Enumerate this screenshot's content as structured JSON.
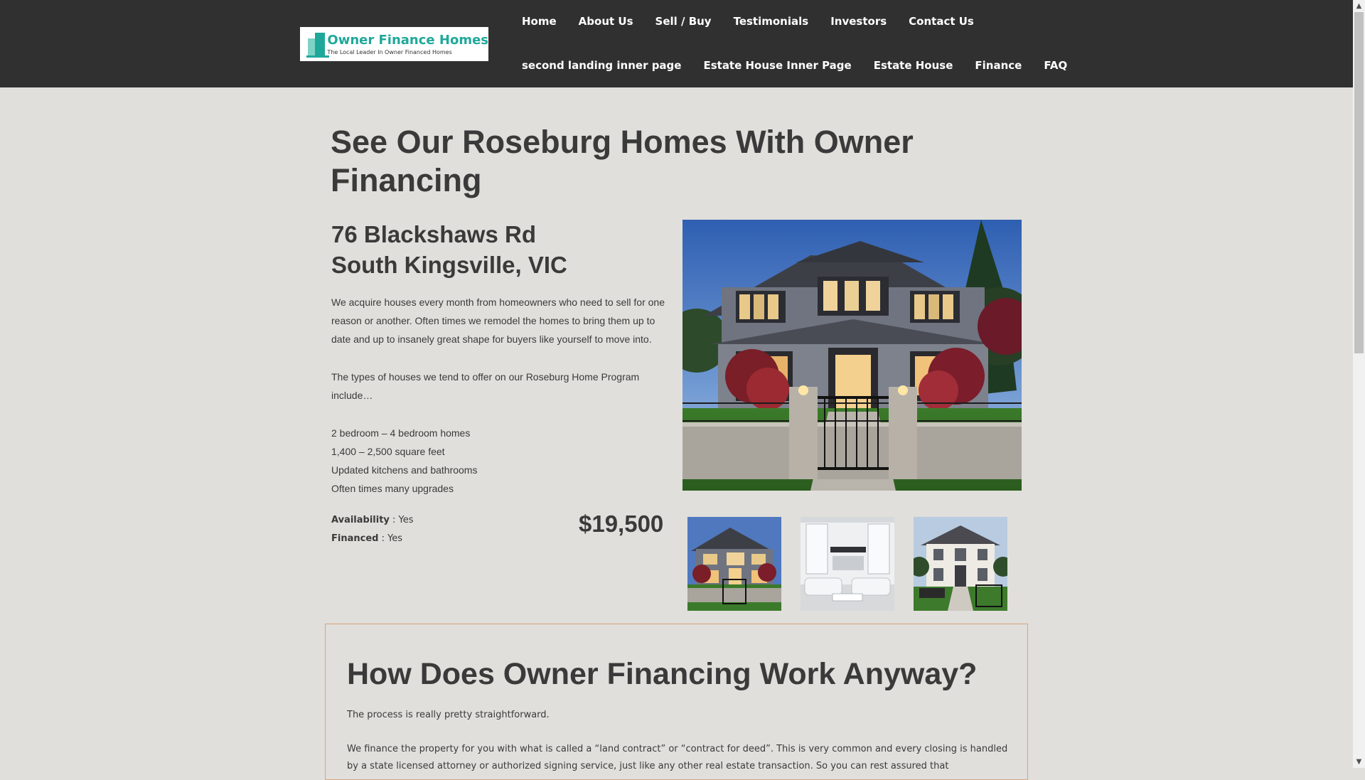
{
  "header": {
    "logo": {
      "title": "Owner Finance Homes",
      "tagline": "The Local Leader In Owner Financed Homes"
    },
    "nav_row1": [
      "Home",
      "About Us",
      "Sell / Buy",
      "Testimonials",
      "Investors",
      "Contact Us"
    ],
    "nav_row2": [
      "second landing inner page",
      "Estate House Inner Page",
      "Estate House",
      "Finance",
      "FAQ"
    ]
  },
  "main": {
    "title": "See Our Roseburg Homes With Owner Financing",
    "address_line1": "76 Blackshaws Rd",
    "address_line2": "South Kingsville, VIC",
    "intro": "We acquire houses every month from homeowners who need to sell for one reason or another. Often times we remodel the homes to bring them up to date and up to insanely great shape for buyers like yourself to move into.",
    "types_intro": "The types of houses we tend to offer on our Roseburg Home Program include…",
    "features": [
      "2 bedroom – 4 bedroom homes",
      "1,400 – 2,500 square feet",
      "Updated kitchens and bathrooms",
      "Often times many upgrades"
    ],
    "availability_label": "Availability",
    "availability_value": " : Yes",
    "financed_label": "Financed",
    "financed_value": " : Yes",
    "price": "$19,500"
  },
  "financing": {
    "title": "How Does Owner Financing Work Anyway?",
    "p1": "The process is really pretty straightforward.",
    "p2": "We finance the property for you with what is called a “land contract” or “contract for deed”. This is very common and every closing is handled by a state licensed attorney or authorized signing service, just like any other real estate transaction. So you can rest assured that"
  },
  "colors": {
    "header_bg": "#303030",
    "page_bg": "#e0dfdb",
    "brand": "#1fa89a",
    "box_border": "#d8a47a"
  },
  "icons": {
    "scroll_up": "▲",
    "scroll_down": "▼"
  }
}
